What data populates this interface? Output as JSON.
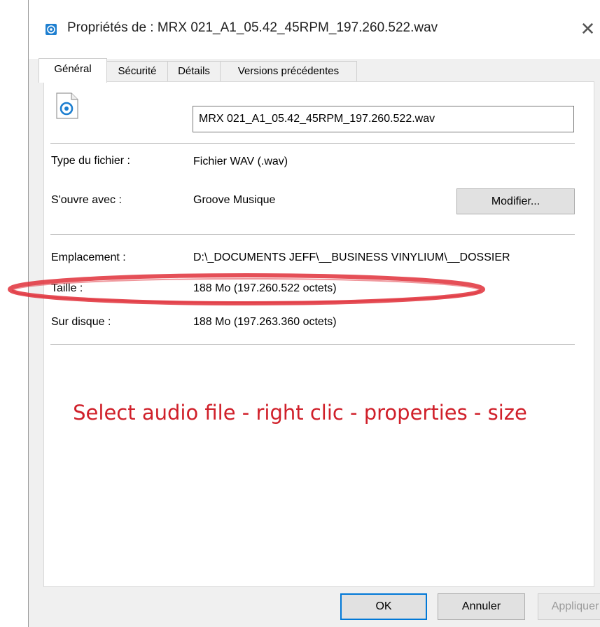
{
  "window": {
    "title": "Propriétés de : MRX 021_A1_05.42_45RPM_197.260.522.wav",
    "close_glyph": "✕"
  },
  "tabs": [
    {
      "label": "Général",
      "active": true
    },
    {
      "label": "Sécurité",
      "active": false
    },
    {
      "label": "Détails",
      "active": false
    },
    {
      "label": "Versions précédentes",
      "active": false
    }
  ],
  "general": {
    "file_icon": "audio-file-icon",
    "filename_value": "MRX 021_A1_05.42_45RPM_197.260.522.wav",
    "type_label": "Type du fichier :",
    "type_value": "Fichier WAV (.wav)",
    "opens_with_label": "S'ouvre avec :",
    "opens_with_value": "Groove Musique",
    "modify_button": "Modifier...",
    "location_label": "Emplacement :",
    "location_value": "D:\\_DOCUMENTS JEFF\\__BUSINESS VINYLIUM\\__DOSSIER",
    "size_label": "Taille :",
    "size_value": "188 Mo (197.260.522 octets)",
    "disk_label": "Sur disque :",
    "disk_value": "188 Mo (197.263.360 octets)"
  },
  "annotation": {
    "text": "Select audio file - right clic - properties - size",
    "color": "#d0202a"
  },
  "buttons": {
    "ok": "OK",
    "cancel": "Annuler",
    "apply": "Appliquer"
  },
  "colors": {
    "accent": "#0078d7",
    "highlight_ellipse": "#e0303a"
  }
}
